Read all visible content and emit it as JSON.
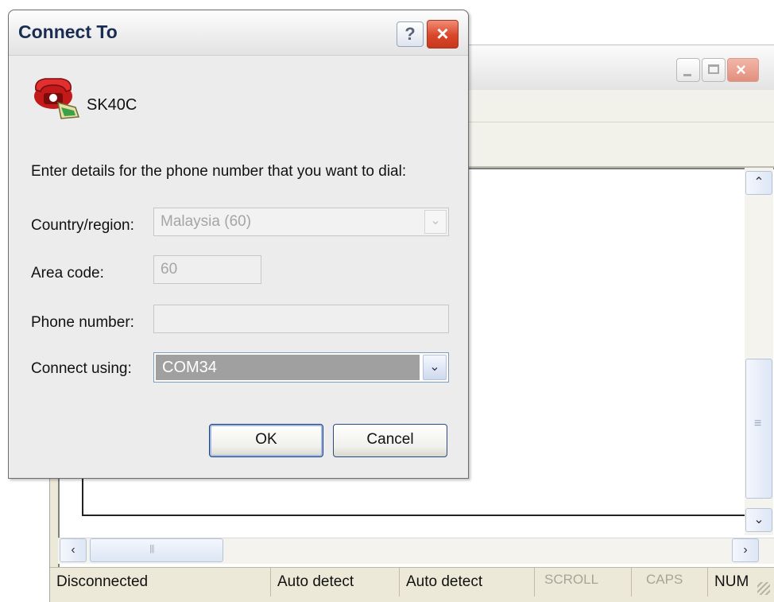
{
  "dialog": {
    "title": "Connect To",
    "help_label": "?",
    "close_label": "×",
    "connection_name": "SK40C",
    "prompt": "Enter details for the phone number that you want to dial:",
    "fields": {
      "country_label": "Country/region:",
      "country_value": "Malaysia (60)",
      "area_label": "Area code:",
      "area_value": "60",
      "phone_label": "Phone number:",
      "phone_value": "",
      "connect_label": "Connect using:",
      "connect_value": "COM34"
    },
    "ok_label": "OK",
    "cancel_label": "Cancel"
  },
  "background_window": {
    "status": {
      "connection": "Disconnected",
      "detect1": "Auto detect",
      "detect2": "Auto detect",
      "scroll": "SCROLL",
      "caps": "CAPS",
      "num": "NUM"
    }
  },
  "icons": {
    "phone": "telephone-icon",
    "dropdown": "chevron-down-icon",
    "scroll_up": "arrow-up-icon",
    "scroll_down": "arrow-down-icon",
    "scroll_left": "arrow-left-icon",
    "scroll_right": "arrow-right-icon"
  },
  "colors": {
    "title_text": "#1a2c52",
    "close_button": "#d9462a",
    "selection_bg": "#a0a0a0",
    "dialog_bg": "#ececec"
  }
}
